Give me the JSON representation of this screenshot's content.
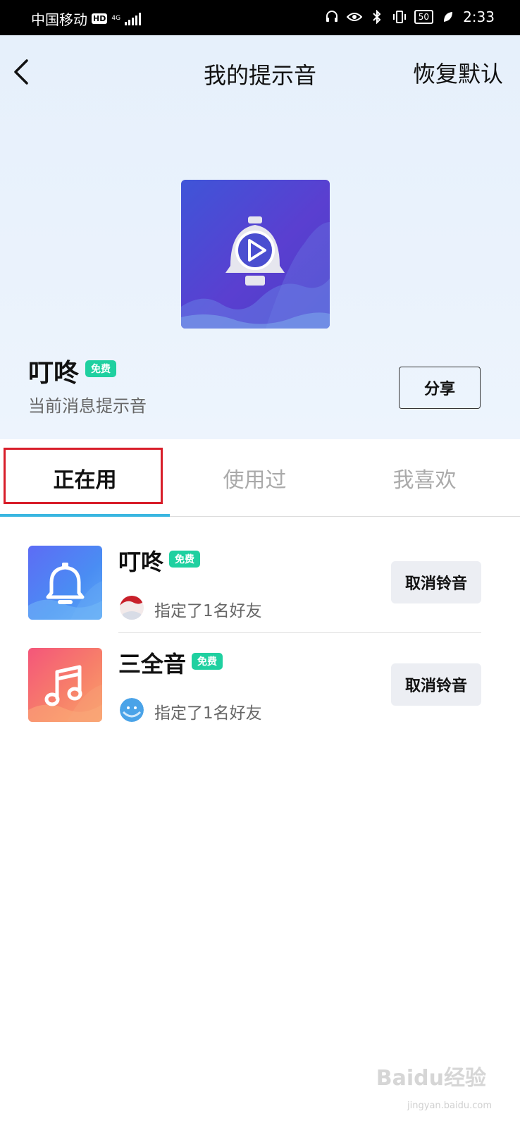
{
  "status_bar": {
    "carrier": "中国移动",
    "hd": "HD",
    "network": "4G",
    "battery": "50",
    "time": "2:33"
  },
  "header": {
    "title": "我的提示音",
    "restore_label": "恢复默认"
  },
  "current_tone": {
    "name": "叮咚",
    "badge": "免费",
    "subtitle": "当前消息提示音",
    "share_label": "分享"
  },
  "tabs": [
    {
      "label": "正在用",
      "active": true
    },
    {
      "label": "使用过",
      "active": false
    },
    {
      "label": "我喜欢",
      "active": false
    }
  ],
  "list": [
    {
      "name": "叮咚",
      "badge": "免费",
      "assigned": "指定了1名好友",
      "action": "取消铃音",
      "icon": "bell-icon"
    },
    {
      "name": "三全音",
      "badge": "免费",
      "assigned": "指定了1名好友",
      "action": "取消铃音",
      "icon": "music-note-icon"
    }
  ],
  "watermark": {
    "text": "Baidu经验",
    "url": "jingyan.baidu.com"
  },
  "colors": {
    "accent": "#3ab6e0",
    "badge": "#1fd0a0",
    "highlight": "#d81e2a"
  }
}
